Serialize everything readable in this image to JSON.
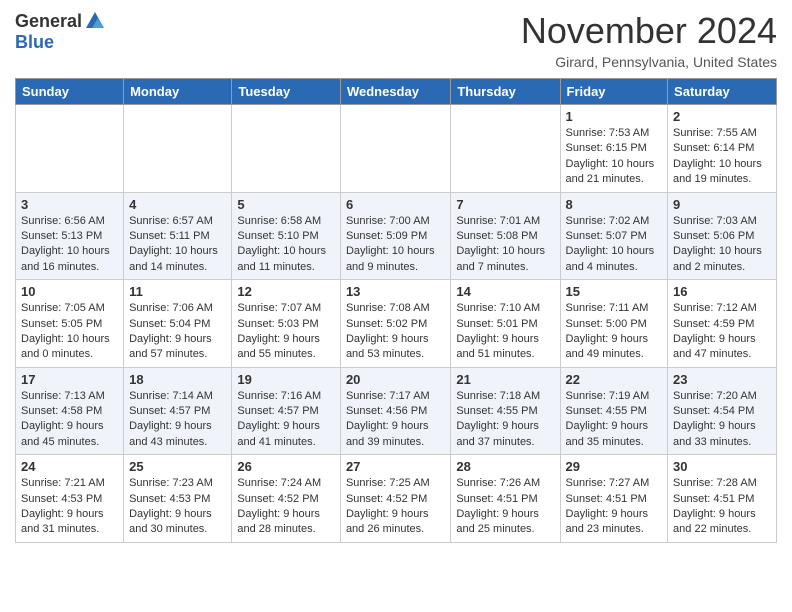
{
  "logo": {
    "general": "General",
    "blue": "Blue"
  },
  "header": {
    "month": "November 2024",
    "location": "Girard, Pennsylvania, United States"
  },
  "weekdays": [
    "Sunday",
    "Monday",
    "Tuesday",
    "Wednesday",
    "Thursday",
    "Friday",
    "Saturday"
  ],
  "weeks": [
    [
      {
        "day": "",
        "info": ""
      },
      {
        "day": "",
        "info": ""
      },
      {
        "day": "",
        "info": ""
      },
      {
        "day": "",
        "info": ""
      },
      {
        "day": "",
        "info": ""
      },
      {
        "day": "1",
        "info": "Sunrise: 7:53 AM\nSunset: 6:15 PM\nDaylight: 10 hours and 21 minutes."
      },
      {
        "day": "2",
        "info": "Sunrise: 7:55 AM\nSunset: 6:14 PM\nDaylight: 10 hours and 19 minutes."
      }
    ],
    [
      {
        "day": "3",
        "info": "Sunrise: 6:56 AM\nSunset: 5:13 PM\nDaylight: 10 hours and 16 minutes."
      },
      {
        "day": "4",
        "info": "Sunrise: 6:57 AM\nSunset: 5:11 PM\nDaylight: 10 hours and 14 minutes."
      },
      {
        "day": "5",
        "info": "Sunrise: 6:58 AM\nSunset: 5:10 PM\nDaylight: 10 hours and 11 minutes."
      },
      {
        "day": "6",
        "info": "Sunrise: 7:00 AM\nSunset: 5:09 PM\nDaylight: 10 hours and 9 minutes."
      },
      {
        "day": "7",
        "info": "Sunrise: 7:01 AM\nSunset: 5:08 PM\nDaylight: 10 hours and 7 minutes."
      },
      {
        "day": "8",
        "info": "Sunrise: 7:02 AM\nSunset: 5:07 PM\nDaylight: 10 hours and 4 minutes."
      },
      {
        "day": "9",
        "info": "Sunrise: 7:03 AM\nSunset: 5:06 PM\nDaylight: 10 hours and 2 minutes."
      }
    ],
    [
      {
        "day": "10",
        "info": "Sunrise: 7:05 AM\nSunset: 5:05 PM\nDaylight: 10 hours and 0 minutes."
      },
      {
        "day": "11",
        "info": "Sunrise: 7:06 AM\nSunset: 5:04 PM\nDaylight: 9 hours and 57 minutes."
      },
      {
        "day": "12",
        "info": "Sunrise: 7:07 AM\nSunset: 5:03 PM\nDaylight: 9 hours and 55 minutes."
      },
      {
        "day": "13",
        "info": "Sunrise: 7:08 AM\nSunset: 5:02 PM\nDaylight: 9 hours and 53 minutes."
      },
      {
        "day": "14",
        "info": "Sunrise: 7:10 AM\nSunset: 5:01 PM\nDaylight: 9 hours and 51 minutes."
      },
      {
        "day": "15",
        "info": "Sunrise: 7:11 AM\nSunset: 5:00 PM\nDaylight: 9 hours and 49 minutes."
      },
      {
        "day": "16",
        "info": "Sunrise: 7:12 AM\nSunset: 4:59 PM\nDaylight: 9 hours and 47 minutes."
      }
    ],
    [
      {
        "day": "17",
        "info": "Sunrise: 7:13 AM\nSunset: 4:58 PM\nDaylight: 9 hours and 45 minutes."
      },
      {
        "day": "18",
        "info": "Sunrise: 7:14 AM\nSunset: 4:57 PM\nDaylight: 9 hours and 43 minutes."
      },
      {
        "day": "19",
        "info": "Sunrise: 7:16 AM\nSunset: 4:57 PM\nDaylight: 9 hours and 41 minutes."
      },
      {
        "day": "20",
        "info": "Sunrise: 7:17 AM\nSunset: 4:56 PM\nDaylight: 9 hours and 39 minutes."
      },
      {
        "day": "21",
        "info": "Sunrise: 7:18 AM\nSunset: 4:55 PM\nDaylight: 9 hours and 37 minutes."
      },
      {
        "day": "22",
        "info": "Sunrise: 7:19 AM\nSunset: 4:55 PM\nDaylight: 9 hours and 35 minutes."
      },
      {
        "day": "23",
        "info": "Sunrise: 7:20 AM\nSunset: 4:54 PM\nDaylight: 9 hours and 33 minutes."
      }
    ],
    [
      {
        "day": "24",
        "info": "Sunrise: 7:21 AM\nSunset: 4:53 PM\nDaylight: 9 hours and 31 minutes."
      },
      {
        "day": "25",
        "info": "Sunrise: 7:23 AM\nSunset: 4:53 PM\nDaylight: 9 hours and 30 minutes."
      },
      {
        "day": "26",
        "info": "Sunrise: 7:24 AM\nSunset: 4:52 PM\nDaylight: 9 hours and 28 minutes."
      },
      {
        "day": "27",
        "info": "Sunrise: 7:25 AM\nSunset: 4:52 PM\nDaylight: 9 hours and 26 minutes."
      },
      {
        "day": "28",
        "info": "Sunrise: 7:26 AM\nSunset: 4:51 PM\nDaylight: 9 hours and 25 minutes."
      },
      {
        "day": "29",
        "info": "Sunrise: 7:27 AM\nSunset: 4:51 PM\nDaylight: 9 hours and 23 minutes."
      },
      {
        "day": "30",
        "info": "Sunrise: 7:28 AM\nSunset: 4:51 PM\nDaylight: 9 hours and 22 minutes."
      }
    ]
  ]
}
